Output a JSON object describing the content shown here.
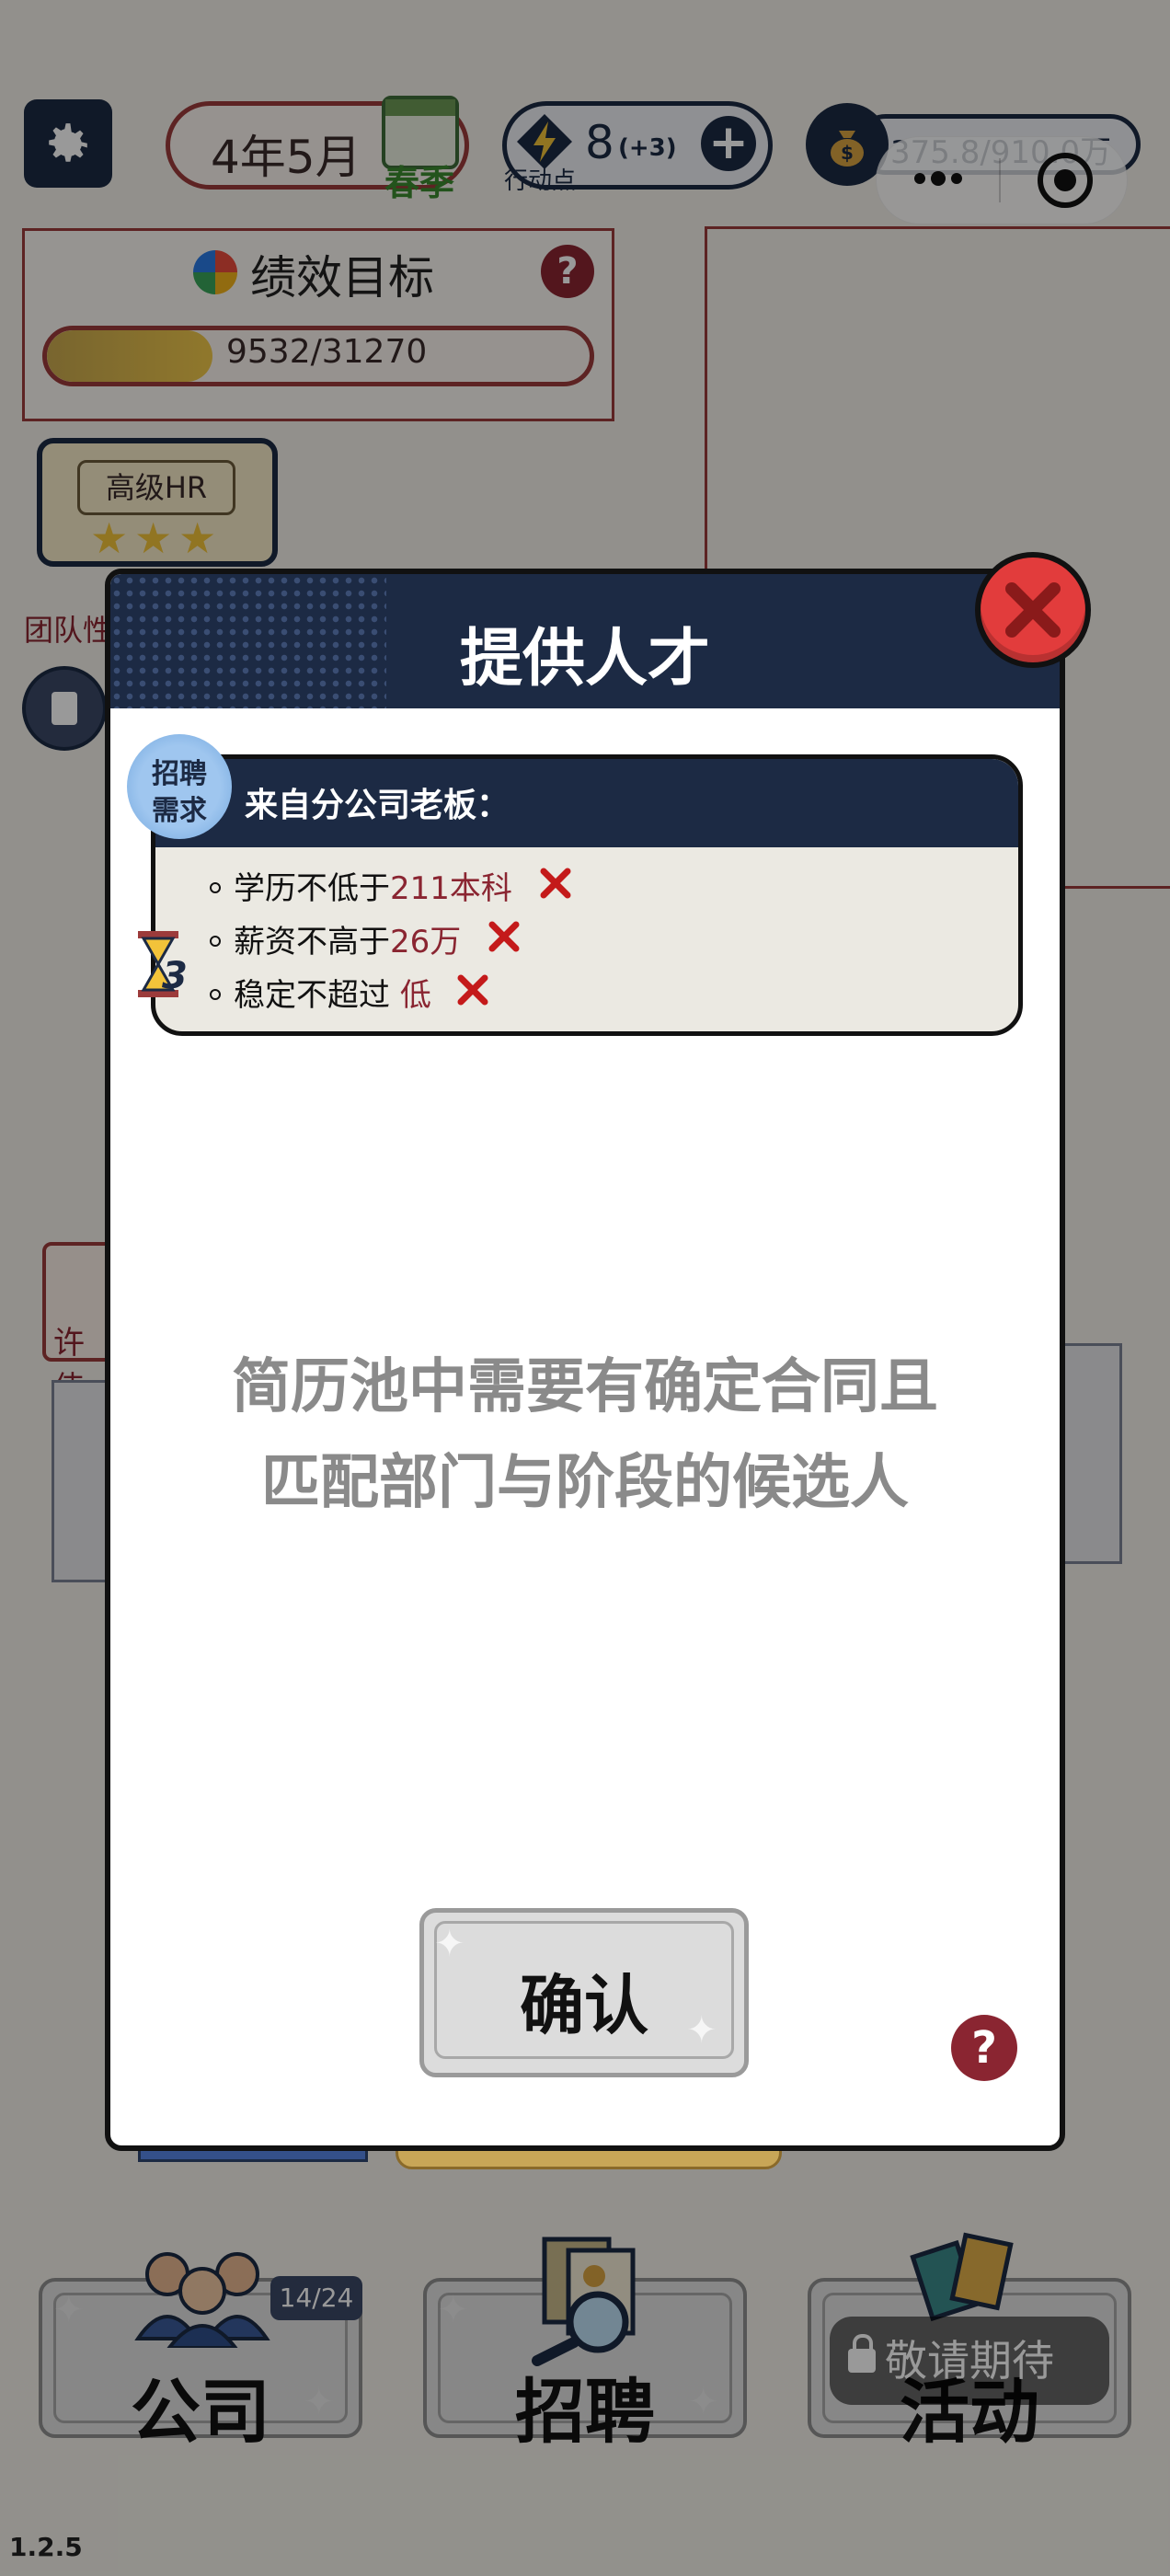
{
  "top_bar": {
    "date": "4年5月",
    "season": "春季",
    "action_points": "8",
    "action_points_bonus": "(+3)",
    "action_points_label": "行动点",
    "money": "375.8/910.0万"
  },
  "performance": {
    "title": "绩效目标",
    "progress_text": "9532/31270",
    "progress_value": 9532,
    "progress_max": 31270
  },
  "hr_badge": {
    "label": "高级HR",
    "stars": 3
  },
  "team_label": "团队性",
  "side_card_label": "许伟",
  "modal": {
    "title": "提供人才",
    "requirement_badge_line1": "招聘",
    "requirement_badge_line2": "需求",
    "from_label": "来自分公司老板：",
    "requirements": [
      {
        "label": "学历不低于",
        "value": "211本科",
        "met": false
      },
      {
        "label": "薪资不高于",
        "value": "26万",
        "met": false
      },
      {
        "label": "稳定不超过 ",
        "value": "低",
        "met": false
      }
    ],
    "timer_value": "3",
    "message_line1": "简历池中需要有确定合同且",
    "message_line2": "匹配部门与阶段的候选人",
    "confirm_label": "确认",
    "help_label": "?"
  },
  "bottom_nav": {
    "company_label": "公司",
    "company_count": "14/24",
    "recruit_label": "招聘",
    "activity_label": "活动",
    "locked_label": "敬请期待"
  },
  "version": "1.2.5",
  "colors": {
    "navy": "#1c2a44",
    "maroon": "#8a2531",
    "close_red": "#e23c3c",
    "gold": "#f0c84a"
  }
}
